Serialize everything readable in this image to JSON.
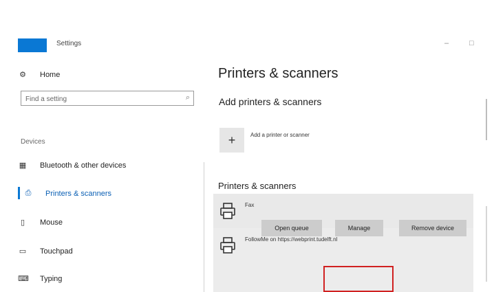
{
  "window": {
    "title": "Settings",
    "minimize_glyph": "–",
    "maximize_glyph": "□"
  },
  "sidebar": {
    "home_label": "Home",
    "search": {
      "placeholder": "Find a setting"
    },
    "section_label": "Devices",
    "items": [
      {
        "label": "Bluetooth & other devices",
        "icon": "bluetooth-devices-icon"
      },
      {
        "label": "Printers & scanners",
        "icon": "printer-icon",
        "active": true
      },
      {
        "label": "Mouse",
        "icon": "mouse-icon"
      },
      {
        "label": "Touchpad",
        "icon": "touchpad-icon"
      },
      {
        "label": "Typing",
        "icon": "keyboard-icon"
      }
    ]
  },
  "main": {
    "title": "Printers & scanners",
    "add_heading": "Add printers & scanners",
    "add_label": "Add a printer or scanner",
    "list_heading": "Printers & scanners",
    "printers": [
      {
        "name": "Fax"
      },
      {
        "name": "FollowMe on https://webprint.tudelft.nl"
      }
    ],
    "buttons": {
      "open_queue": "Open queue",
      "manage": "Manage",
      "remove_device": "Remove device"
    }
  },
  "colors": {
    "accent": "#0a78d4",
    "highlight": "#d02020",
    "row_selected": "#ececec"
  }
}
